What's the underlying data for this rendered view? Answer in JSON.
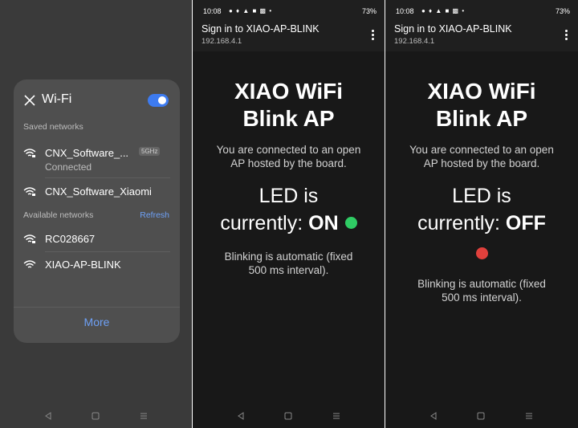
{
  "wifi": {
    "title": "Wi-Fi",
    "toggle_on": true,
    "saved_label": "Saved networks",
    "saved": [
      {
        "name": "CNX_Software_...",
        "badge": "5GHz",
        "status": "Connected"
      },
      {
        "name": "CNX_Software_Xiaomi"
      }
    ],
    "available_label": "Available networks",
    "refresh": "Refresh",
    "available": [
      {
        "name": "RC028667"
      },
      {
        "name": "XIAO-AP-BLINK"
      }
    ],
    "more": "More"
  },
  "status_bar": {
    "time": "10:08",
    "battery": "73%"
  },
  "portal": {
    "title_line1": "Sign in to XIAO-AP-BLINK",
    "ip": "192.168.4.1",
    "heading_line1": "XIAO WiFi",
    "heading_line2": "Blink AP",
    "desc_line1": "You are connected to an open",
    "desc_line2": "AP hosted by the board.",
    "led_line1": "LED is",
    "led_prefix": "currently:",
    "note_line1": "Blinking is automatic (fixed",
    "note_line2": "500 ms interval)."
  },
  "screen_on": {
    "led_state": "ON",
    "dot_color": "#2fcc64"
  },
  "screen_off": {
    "led_state": "OFF",
    "dot_color": "#e0403c"
  }
}
